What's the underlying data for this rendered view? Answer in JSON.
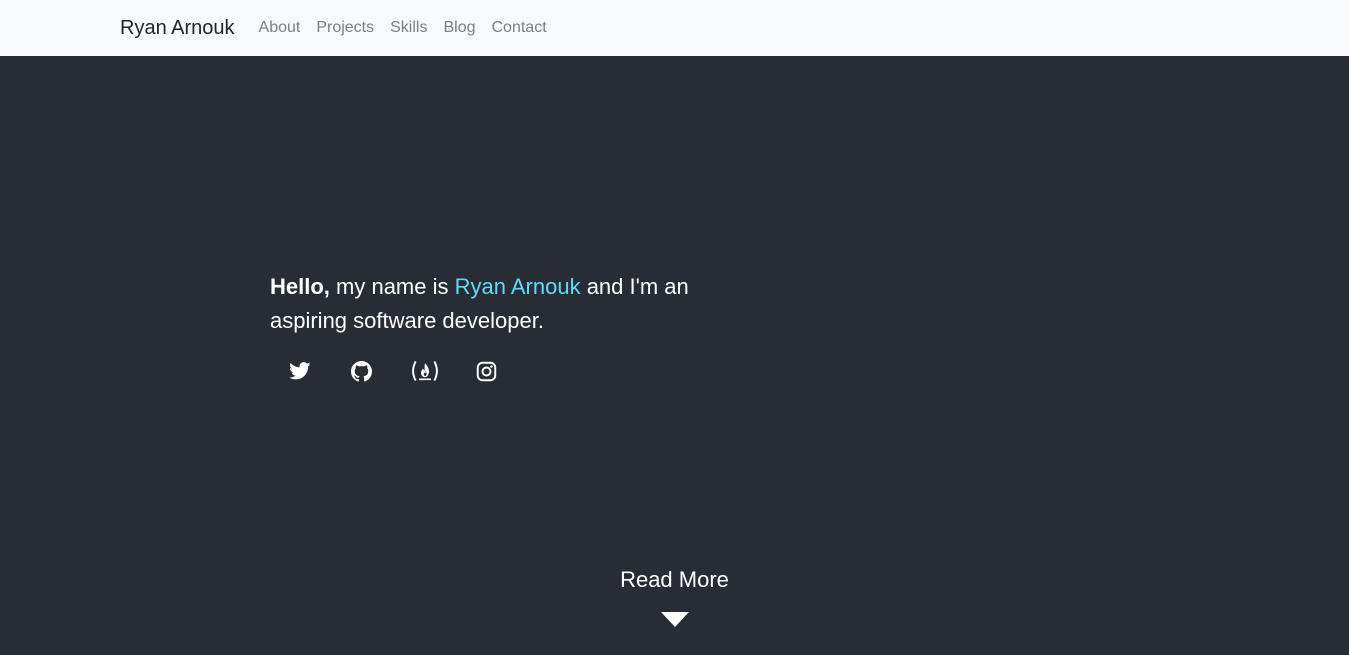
{
  "navbar": {
    "brand": "Ryan Arnouk",
    "links": [
      "About",
      "Projects",
      "Skills",
      "Blog",
      "Contact"
    ]
  },
  "hero": {
    "greeting": "Hello,",
    "text_before_name": " my name is ",
    "name": "Ryan Arnouk",
    "text_after_name": " and I'm an aspiring software developer."
  },
  "socials": [
    {
      "icon": "twitter-icon"
    },
    {
      "icon": "github-icon"
    },
    {
      "icon": "freecodecamp-icon"
    },
    {
      "icon": "instagram-icon"
    }
  ],
  "read_more": {
    "label": "Read More",
    "icon": "caret-down-icon"
  },
  "colors": {
    "background": "#282c34",
    "navbar": "#f8f9fa",
    "accent": "#61dafb",
    "text": "#ffffff"
  }
}
